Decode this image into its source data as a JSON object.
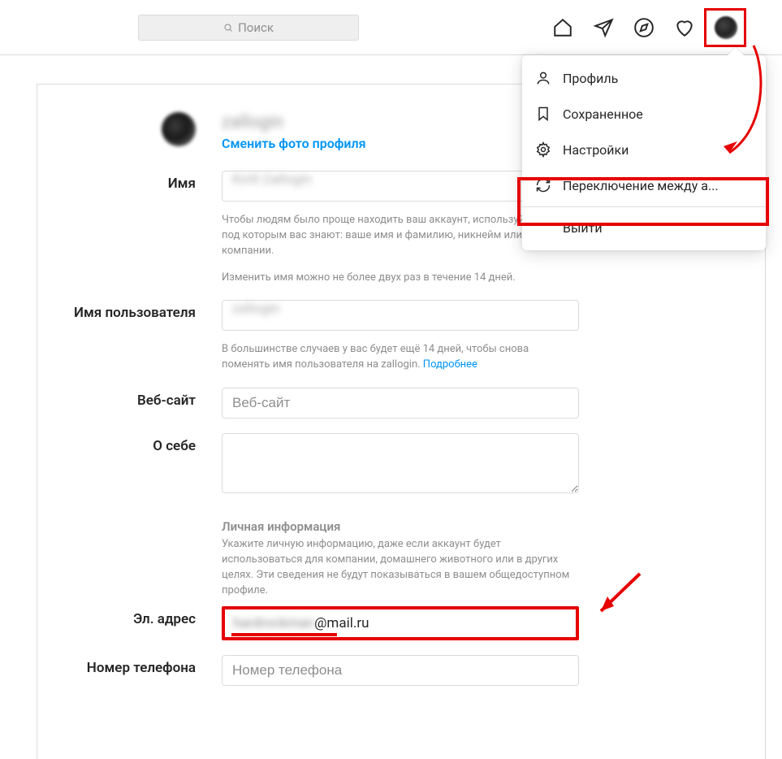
{
  "search": {
    "placeholder": "Поиск"
  },
  "dropdown": {
    "profile": "Профиль",
    "saved": "Сохраненное",
    "settings": "Настройки",
    "switch": "Переключение между а...",
    "logout": "Выйти"
  },
  "profile": {
    "username_blur": "zallogin",
    "change_photo": "Сменить фото профиля"
  },
  "form": {
    "name_label": "Имя",
    "name_value_blur": "Kirill Zallogin",
    "name_help1": "Чтобы людям было проще находить ваш аккаунт, используйте имя, под которым вас знают: ваше имя и фамилию, никнейм или название компании.",
    "name_help2": "Изменить имя можно не более двух раз в течение 14 дней.",
    "username_label": "Имя пользователя",
    "username_value_blur": "zallogin",
    "username_help_pre": "В большинстве случаев у вас будет ещё 14 дней, чтобы снова поменять имя пользователя на zallogin. ",
    "username_help_link": "Подробнее",
    "website_label": "Веб-сайт",
    "website_placeholder": "Веб-сайт",
    "bio_label": "О себе",
    "personal_title": "Личная информация",
    "personal_help": "Укажите личную информацию, даже если аккаунт будет использоваться для компании, домашнего животного или в других целях. Эти сведения не будут показываться в вашем общедоступном профиле.",
    "email_label": "Эл. адрес",
    "email_blur_part": "hardrockman",
    "email_visible_part": "@mail.ru",
    "phone_label": "Номер телефона",
    "phone_placeholder": "Номер телефона"
  }
}
